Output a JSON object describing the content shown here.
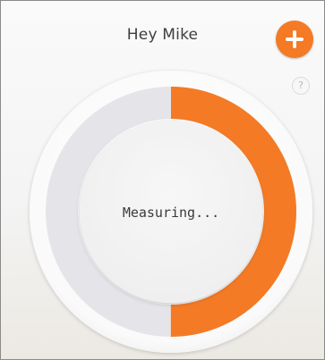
{
  "header": {
    "greeting": "Hey Mike",
    "add_icon": "plus-icon",
    "help_label": "?"
  },
  "gauge": {
    "status": "Measuring...",
    "progress_fraction": 0.5,
    "colors": {
      "progress": "#f47a25",
      "track": "#e5e5e9",
      "face": "#f3f3f3",
      "accent": "#f47a25"
    }
  }
}
